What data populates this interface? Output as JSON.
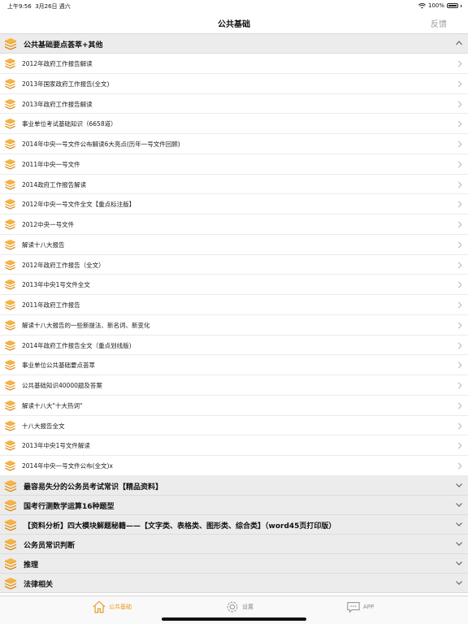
{
  "status": {
    "time": "上午9:56",
    "date": "3月26日 週六",
    "battery": "100%"
  },
  "nav": {
    "title": "公共基础",
    "feedback": "反馈"
  },
  "expanded_group": {
    "title": "公共基础要点荟萃+其他",
    "items": [
      "2012年政府工作报告解读",
      "2013年国家政府工作报告(全文)",
      "2013年政府工作报告解读",
      "事业单位考试基础知识（6658道）",
      "2014年中央一号文件公布解读6大亮点(历年一号文件回顾)",
      "2011年中央一号文件",
      "2014政府工作报告解读",
      "2012年中央一号文件全文【重点标注版】",
      "2012中央一号文件",
      "解读十八大报告",
      "2012年政府工作报告（全文）",
      "2013年中央1号文件全文",
      "2011年政府工作报告",
      "解读十八大报告的一些新提法、新名词、新变化",
      "2014年政府工作报告全文（重点划线版)",
      "事业单位公共基础要点荟萃",
      "公共基础知识40000题及答案",
      "解读十八大\"十大热词\"",
      "十八大报告全文",
      "2013年中央1号文件解读",
      "2014年中央一号文件公布(全文)x"
    ]
  },
  "collapsed_groups": [
    "最容易失分的公务员考试常识【精品资料】",
    "国考行测数学运算16种题型",
    "【资料分析】四大模块解题秘籍——【文字类、表格类、图形类、综合类】（word45页打印版）",
    "公务员常识判断",
    "推理",
    "法律相关"
  ],
  "tabs": [
    {
      "label": "公共基础",
      "icon": "home-icon",
      "active": true
    },
    {
      "label": "设置",
      "icon": "gear-icon",
      "active": false
    },
    {
      "label": "APP",
      "icon": "chat-icon",
      "active": false
    }
  ],
  "colors": {
    "accent": "#e99a1b",
    "book": "#f0a22a",
    "header_bg": "#ececec"
  }
}
